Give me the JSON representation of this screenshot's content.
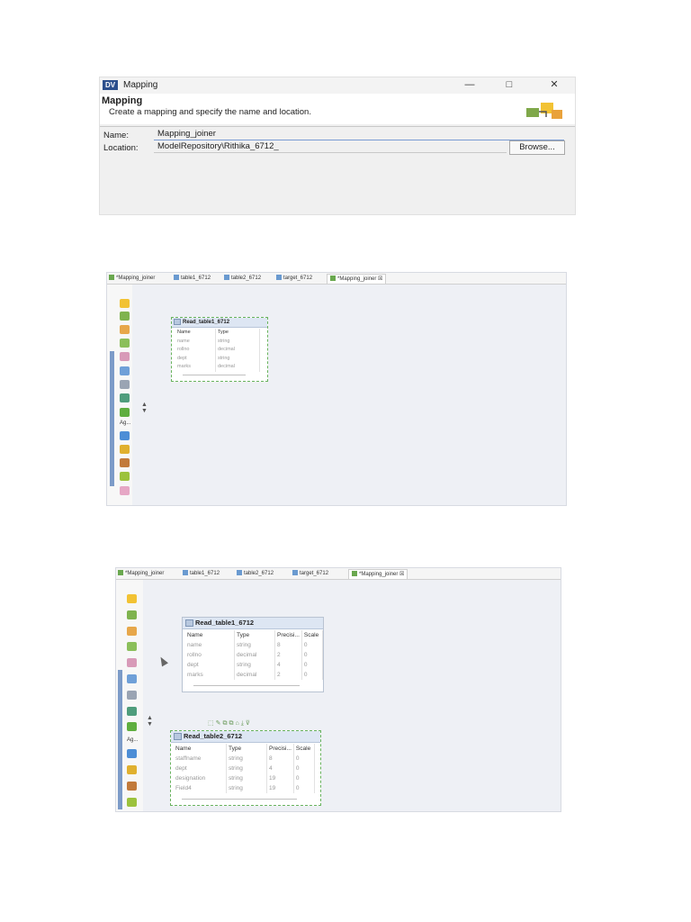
{
  "dialog": {
    "app_badge": "DV",
    "window_title": "Mapping",
    "header_title": "Mapping",
    "header_description": "Create a mapping and specify the name and location.",
    "name_label": "Name:",
    "name_value": "Mapping_joiner",
    "location_label": "Location:",
    "location_value": "ModelRepository\\Rithika_6712_",
    "browse_button": "Browse...",
    "minimize": "—",
    "maximize": "□",
    "close": "✕"
  },
  "editor1": {
    "tabs": [
      {
        "label": "*Mapping_joiner",
        "kind": "map"
      },
      {
        "label": "table1_6712",
        "kind": "table"
      },
      {
        "label": "table2_6712",
        "kind": "table"
      },
      {
        "label": "target_6712",
        "kind": "table"
      },
      {
        "label": "*Mapping_joiner",
        "kind": "map",
        "active": true,
        "close": "☒"
      }
    ],
    "palette_label": "Ag...",
    "object": {
      "title": "Read_table1_6712",
      "columns": [
        "Name",
        "Type"
      ],
      "rows": [
        [
          "name",
          "string"
        ],
        [
          "rollno",
          "decimal"
        ],
        [
          "dept",
          "string"
        ],
        [
          "marks",
          "decimal"
        ]
      ]
    }
  },
  "editor2": {
    "tabs": [
      {
        "label": "*Mapping_joiner",
        "kind": "map"
      },
      {
        "label": "table1_6712",
        "kind": "table"
      },
      {
        "label": "table2_6712",
        "kind": "table"
      },
      {
        "label": "target_6712",
        "kind": "table"
      },
      {
        "label": "*Mapping_joiner",
        "kind": "map",
        "active": true,
        "close": "☒"
      }
    ],
    "palette_label": "Ag...",
    "object1": {
      "title": "Read_table1_6712",
      "columns": [
        "Name",
        "Type",
        "Precisi...",
        "Scale"
      ],
      "rows": [
        [
          "name",
          "string",
          "8",
          "0"
        ],
        [
          "rollno",
          "decimal",
          "2",
          "0"
        ],
        [
          "dept",
          "string",
          "4",
          "0"
        ],
        [
          "marks",
          "decimal",
          "2",
          "0"
        ]
      ]
    },
    "object2": {
      "title": "Read_table2_6712",
      "columns": [
        "Name",
        "Type",
        "Precisi...",
        "Scale"
      ],
      "rows": [
        [
          "staffname",
          "string",
          "8",
          "0"
        ],
        [
          "dept",
          "string",
          "4",
          "0"
        ],
        [
          "designation",
          "string",
          "19",
          "0"
        ],
        [
          "Field4",
          "string",
          "19",
          "0"
        ]
      ]
    }
  }
}
